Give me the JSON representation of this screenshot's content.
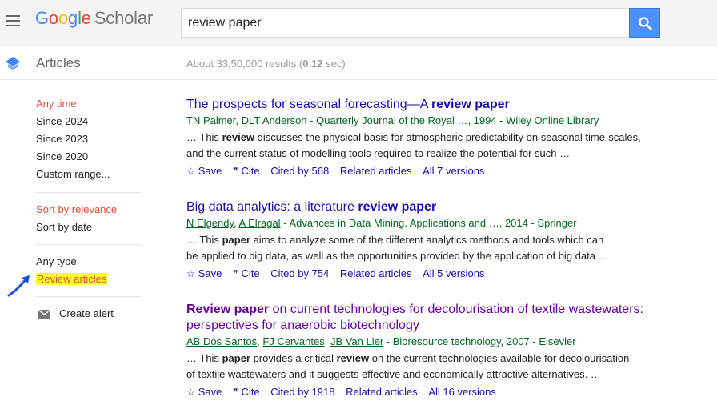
{
  "header": {
    "logo_letters": [
      "G",
      "o",
      "o",
      "g",
      "l",
      "e"
    ],
    "logo_suffix": "Scholar",
    "search_value": "review paper"
  },
  "subheader": {
    "title": "Articles",
    "results_prefix": "About 33,50,000 results (",
    "results_time": "0.12",
    "results_suffix": " sec)"
  },
  "sidebar": {
    "time_items": [
      "Any time",
      "Since 2024",
      "Since 2023",
      "Since 2020",
      "Custom range..."
    ],
    "sort_items": [
      "Sort by relevance",
      "Sort by date"
    ],
    "type_items": [
      "Any type",
      "Review articles"
    ],
    "create_alert": "Create alert"
  },
  "results": [
    {
      "title_pre": "The prospects for seasonal forecasting—A ",
      "title_bold": "review paper",
      "title_post": "",
      "authors_plain": "TN Palmer, DLT Anderson",
      "source": " - Quarterly Journal of the Royal …, 1994 - Wiley Online Library",
      "snippet1_pre": "… This ",
      "snippet1_bold": "review",
      "snippet1_post": " discusses the physical basis for atmospheric predictability on seasonal time-scales,",
      "snippet2": "and the current status of modelling tools required to realize the potential for such …",
      "save": "Save",
      "cite": "Cite",
      "cited_by": "Cited by 568",
      "related": "Related articles",
      "versions": "All 7 versions"
    },
    {
      "title_pre": "Big data analytics: a literature ",
      "title_bold": "review paper",
      "title_post": "",
      "author_links": [
        "N Elgendy",
        "A Elragal"
      ],
      "source": " - Advances in Data Mining. Applications and …, 2014 - Springer",
      "snippet1_pre": "… This ",
      "snippet1_bold": "paper",
      "snippet1_post": " aims to analyze some of the different analytics methods and tools which can",
      "snippet2": "be applied to big data, as well as the opportunities provided by the application of big data …",
      "save": "Save",
      "cite": "Cite",
      "cited_by": "Cited by 754",
      "related": "Related articles",
      "versions": "All 5 versions"
    },
    {
      "title_bold": "Review paper",
      "title_post": " on current technologies for decolourisation of textile wastewaters:",
      "title_line2": "perspectives for anaerobic biotechnology",
      "author_links": [
        "AB Dos Santos",
        "FJ Cervantes",
        "JB Van Lier"
      ],
      "source": " - Bioresource technology, 2007 - Elsevier",
      "snippet1_pre": "… This ",
      "snippet1_bold": "paper",
      "snippet1_mid": " provides a critical ",
      "snippet1_bold2": "review",
      "snippet1_post": " on the current technologies available for decolourisation",
      "snippet2": "of textile wastewaters and it suggests effective and economically attractive alternatives. …",
      "save": "Save",
      "cite": "Cite",
      "cited_by": "Cited by 1918",
      "related": "Related articles",
      "versions": "All 16 versions"
    }
  ],
  "colors": {
    "link_blue": "#1a0dab",
    "visited_purple": "#660099",
    "green_meta": "#006621",
    "active_red": "#dd4b39",
    "highlight": "#ffff33",
    "search_button": "#4d90fe"
  },
  "icons": [
    "menu-icon",
    "search-icon",
    "articles-icon",
    "star-icon",
    "quote-icon",
    "mail-icon",
    "arrow-icon"
  ]
}
